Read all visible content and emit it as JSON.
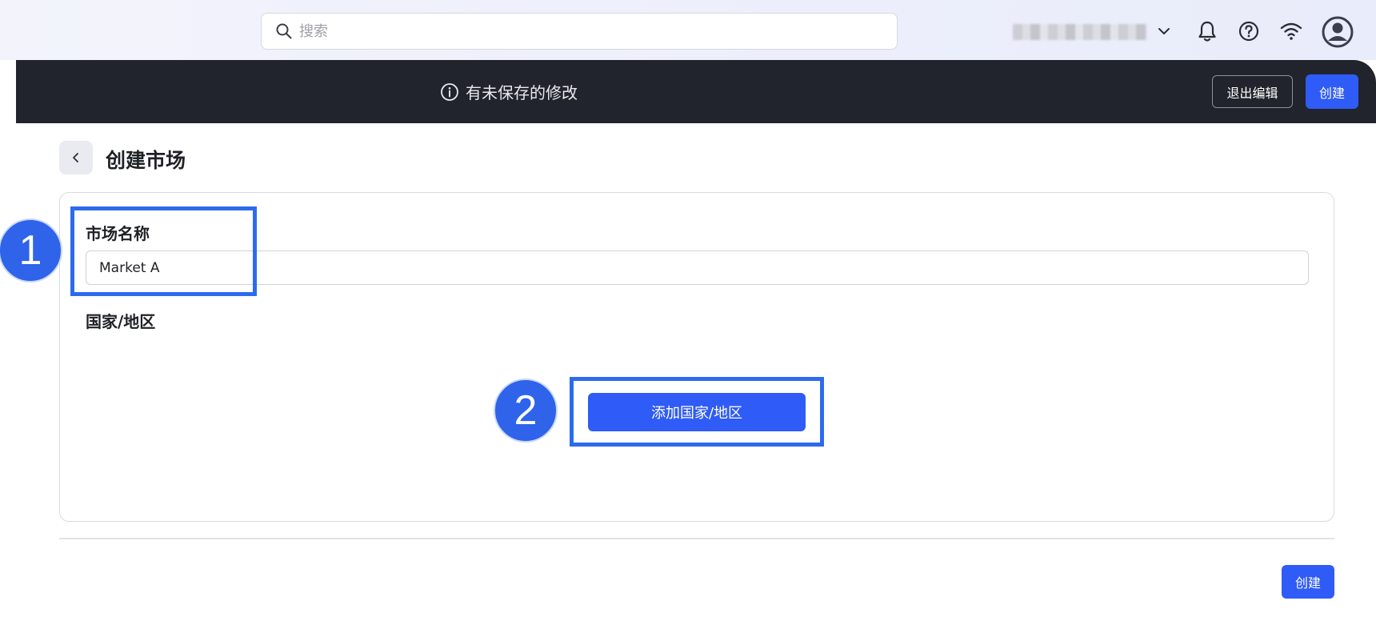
{
  "topbar": {
    "search_placeholder": "搜索",
    "icons": [
      "search-icon",
      "chevron-down-icon",
      "bell-icon",
      "help-icon",
      "wifi-icon",
      "avatar-icon"
    ]
  },
  "banner": {
    "message": "有未保存的修改",
    "exit_label": "退出编辑",
    "create_label": "创建"
  },
  "page": {
    "title": "创建市场"
  },
  "form": {
    "market_name_label": "市场名称",
    "market_name_value": "Market A",
    "country_label": "国家/地区",
    "add_country_label": "添加国家/地区"
  },
  "annotations": {
    "step1": "1",
    "step2": "2",
    "highlight_color": "#2d6bee"
  },
  "footer": {
    "create_label": "创建"
  },
  "colors": {
    "accent": "#2f5bf6",
    "dark_bar": "#21242c"
  }
}
